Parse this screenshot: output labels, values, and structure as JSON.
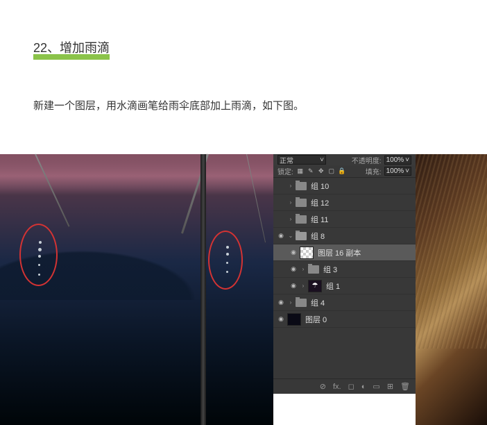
{
  "step": {
    "title": "22、增加雨滴",
    "description": "新建一个图层，用水滴画笔给雨伞底部加上雨滴，如下图。"
  },
  "layers_panel": {
    "blend_mode": "正常",
    "opacity_label": "不透明度:",
    "opacity_value": "100%",
    "lock_label": "锁定:",
    "fill_label": "填充:",
    "fill_value": "100%",
    "items": [
      {
        "name": "组 10",
        "visible": false
      },
      {
        "name": "组 12",
        "visible": false
      },
      {
        "name": "组 11",
        "visible": false
      },
      {
        "name": "组 8",
        "visible": true,
        "open": true
      },
      {
        "name": "图层 16 副本",
        "visible": true,
        "selected": true
      },
      {
        "name": "组 3",
        "visible": true
      },
      {
        "name": "组 1",
        "visible": true
      },
      {
        "name": "组 4",
        "visible": true
      },
      {
        "name": "图层 0",
        "visible": true
      }
    ]
  }
}
